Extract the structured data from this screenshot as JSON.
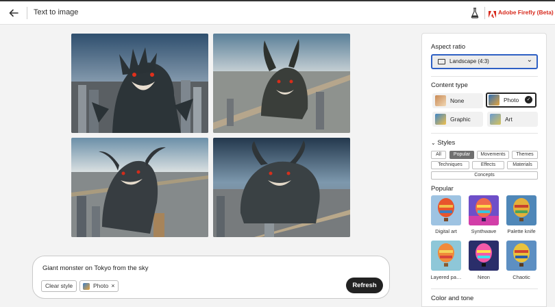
{
  "header": {
    "title": "Text to image",
    "brand": "Adobe Firefly (Beta)",
    "brand_color": "#d7291c"
  },
  "prompt": {
    "text": "Giant monster on Tokyo from the sky",
    "clear_style_label": "Clear style",
    "content_chip_label": "Photo",
    "remove_symbol": "×",
    "refresh_label": "Refresh"
  },
  "panel": {
    "aspect_ratio_heading": "Aspect ratio",
    "aspect_ratio_value": "Landscape (4:3)",
    "content_type_heading": "Content type",
    "content_types": [
      {
        "label": "None",
        "selected": false
      },
      {
        "label": "Photo",
        "selected": true
      },
      {
        "label": "Graphic",
        "selected": false
      },
      {
        "label": "Art",
        "selected": false
      }
    ],
    "styles_heading": "Styles",
    "style_tabs": [
      "All",
      "Popular",
      "Movements",
      "Themes",
      "Techniques",
      "Effects",
      "Materials",
      "Concepts"
    ],
    "active_style_tab": "Popular",
    "popular_heading": "Popular",
    "popular_styles": [
      "Digital art",
      "Synthwave",
      "Palette knife",
      "Layered pa…",
      "Neon",
      "Chaotic"
    ],
    "color_and_tone_heading": "Color and tone"
  }
}
